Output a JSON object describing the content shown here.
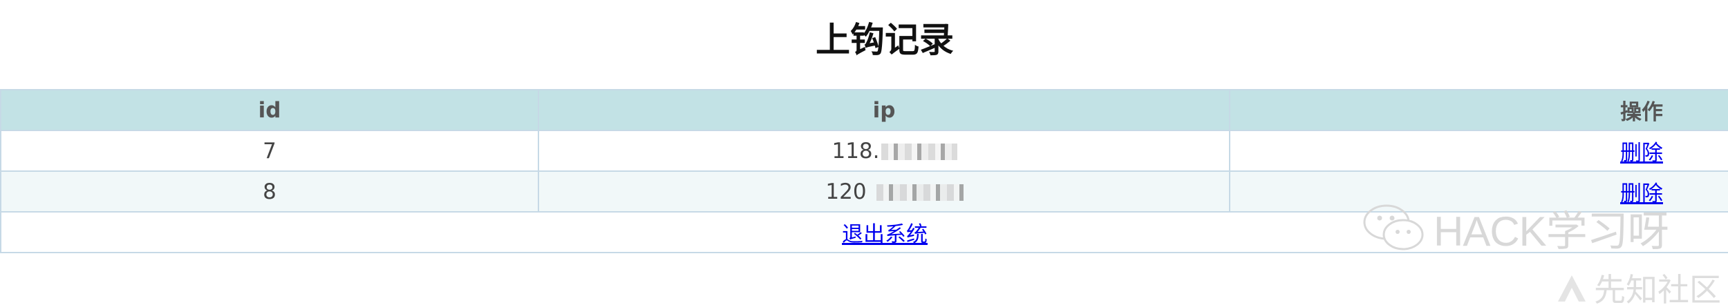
{
  "page": {
    "title": "上钩记录"
  },
  "table": {
    "headers": {
      "id": "id",
      "ip": "ip",
      "action": "操作"
    },
    "rows": [
      {
        "id": "7",
        "ip": "118.",
        "action": "删除"
      },
      {
        "id": "8",
        "ip": "120",
        "action": "删除"
      }
    ],
    "logout_label": "退出系统"
  },
  "watermarks": {
    "wechat": "HACK学习呀",
    "xianzhi": "先知社区"
  },
  "colors": {
    "header_bg": "#c2e2e5",
    "stripe_bg": "#f1f8f9",
    "border": "#c6d9e6",
    "link": "#0000ee"
  }
}
